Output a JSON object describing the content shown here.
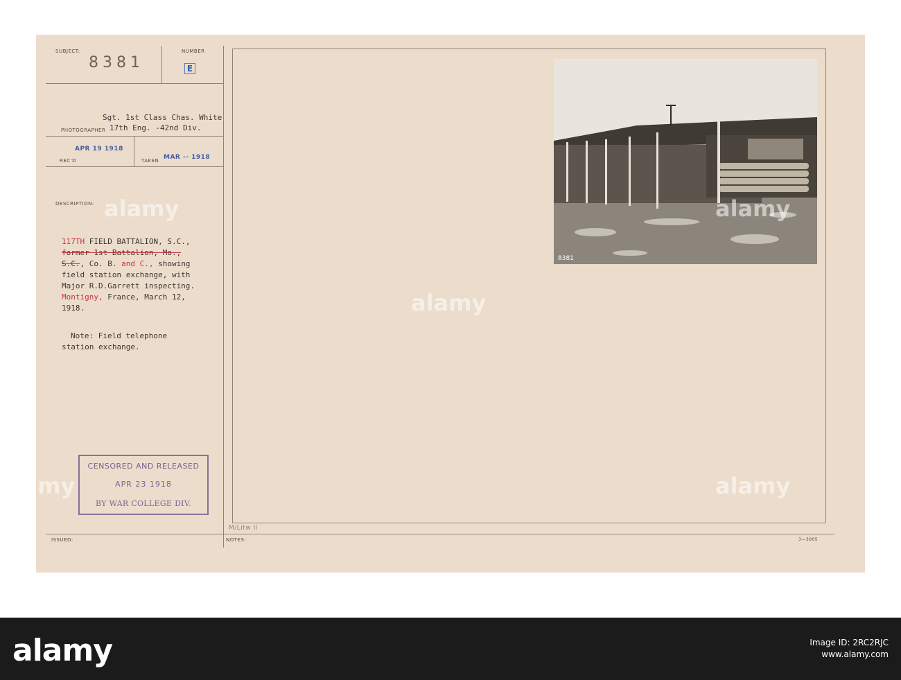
{
  "card": {
    "subject_label": "SUBJECT:",
    "subject_number": "8381",
    "number_label": "NUMBER",
    "number_value": "E",
    "photographer_name": "Sgt. 1st Class Chas. White",
    "photographer_label": "PHOTOGRAPHER",
    "photographer_unit": "17th Eng. -42nd Div.",
    "recd_label": "REC'D",
    "recd_date": "APR 19 1918",
    "taken_label": "TAKEN",
    "taken_date": "MAR -- 1918",
    "description_label": "DESCRIPTION:",
    "description": {
      "line1_red": "117TH",
      "line1_rest": " FIELD BATTALION, S.C.,",
      "line2_strike": "former 1st Battalion, Mo.,",
      "line3_strike": "S.C.",
      "line3_mid": ", Co. B.",
      "line3_red": " and C., ",
      "line3_end": "showing",
      "line4": "field station exchange, with",
      "line5": "Major R.D.Garrett inspecting.",
      "line6_red": "Montigny,",
      "line6_rest": " France, March 12,",
      "line7": "1918."
    },
    "note_line1": "Note: Field telephone",
    "note_line2": "station exchange.",
    "censor_stamp": {
      "line1": "CENSORED AND RELEASED",
      "line2": "APR 23 1918",
      "line3": "BY WAR COLLEGE DIV."
    },
    "issued_label": "ISSUED:",
    "notes_label": "NOTES:",
    "notes_handwriting": "M/Litw Il",
    "form_code": "3—3005",
    "photo_number": "8381"
  },
  "watermark": {
    "text": "alamy"
  },
  "footer": {
    "logo": "alamy",
    "image_id_line1": "Image ID: 2RC2RJC",
    "image_id_line2": "www.alamy.com"
  },
  "colors": {
    "card": "#ecdccb",
    "stamp_blue": "#465ea1",
    "typed_red": "#c53540",
    "censor_purple": "#7b6090",
    "footer": "#1b1b1b"
  }
}
